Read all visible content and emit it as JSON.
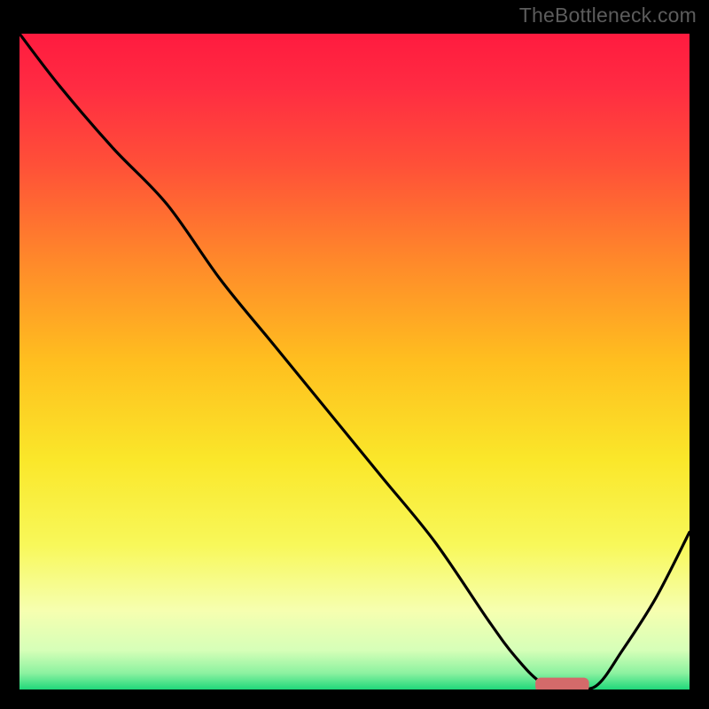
{
  "watermark": "TheBottleneck.com",
  "chart_data": {
    "type": "line",
    "title": "",
    "xlabel": "",
    "ylabel": "",
    "xlim": [
      0,
      100
    ],
    "ylim": [
      0,
      100
    ],
    "grid": false,
    "legend": false,
    "background_gradient": {
      "stops": [
        {
          "offset": 0.0,
          "color": "#ff1b3f"
        },
        {
          "offset": 0.08,
          "color": "#ff2b42"
        },
        {
          "offset": 0.2,
          "color": "#ff5038"
        },
        {
          "offset": 0.35,
          "color": "#ff8a2a"
        },
        {
          "offset": 0.5,
          "color": "#ffbf1f"
        },
        {
          "offset": 0.65,
          "color": "#fae72a"
        },
        {
          "offset": 0.78,
          "color": "#f8f85a"
        },
        {
          "offset": 0.88,
          "color": "#f6ffb0"
        },
        {
          "offset": 0.94,
          "color": "#d6ffb8"
        },
        {
          "offset": 0.975,
          "color": "#8cf2a0"
        },
        {
          "offset": 1.0,
          "color": "#1fd77a"
        }
      ]
    },
    "series": [
      {
        "name": "curve",
        "color": "#000000",
        "x": [
          0.0,
          6.0,
          14.0,
          22.0,
          30.0,
          38.0,
          46.0,
          54.0,
          62.0,
          70.0,
          74.0,
          78.0,
          82.0,
          86.0,
          90.0,
          95.0,
          100.0
        ],
        "y": [
          100.0,
          92.0,
          82.5,
          74.0,
          62.5,
          52.5,
          42.5,
          32.5,
          22.5,
          10.5,
          5.0,
          1.0,
          0.5,
          0.5,
          6.0,
          14.0,
          24.0
        ]
      }
    ],
    "marker": {
      "name": "target-marker",
      "color": "#d46a6a",
      "x_start": 77.0,
      "x_end": 85.0,
      "y": 0.7,
      "thickness": 2.2
    }
  }
}
